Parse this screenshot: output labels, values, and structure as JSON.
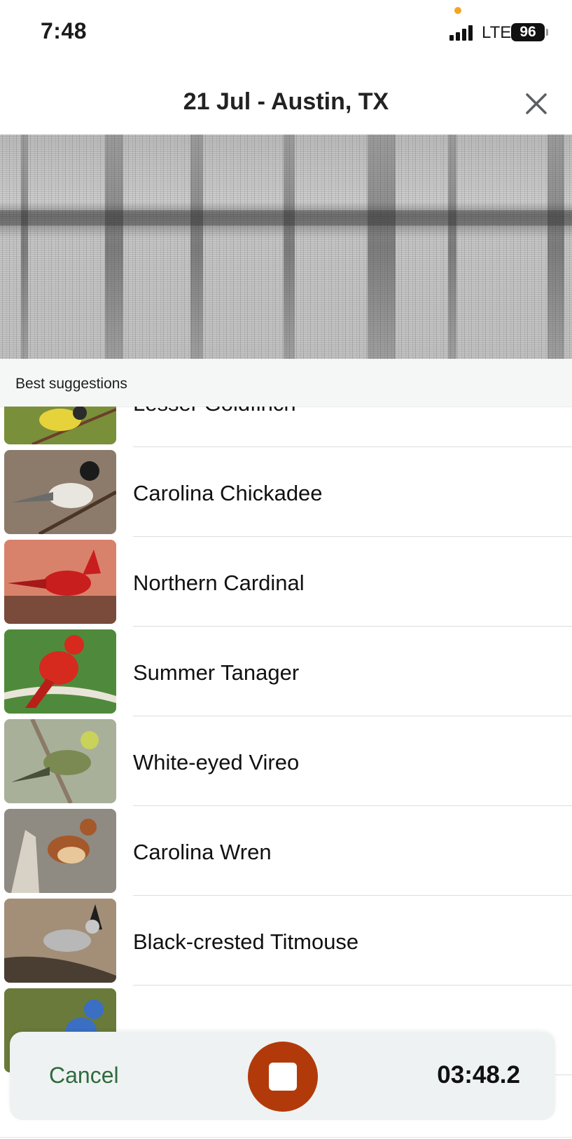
{
  "status_bar": {
    "time": "7:48",
    "network": "LTE",
    "battery": "96"
  },
  "header": {
    "title": "21 Jul - Austin, TX",
    "close_icon": "close-icon"
  },
  "section": {
    "title": "Best suggestions"
  },
  "species": [
    {
      "name": "Lesser Goldfinch",
      "colors": [
        "#7a8f3a",
        "#e6d23a",
        "#2b2b2b"
      ]
    },
    {
      "name": "Carolina Chickadee",
      "colors": [
        "#8c7b6a",
        "#1b1b1b",
        "#e9e6df"
      ]
    },
    {
      "name": "Northern Cardinal",
      "colors": [
        "#d9826b",
        "#c81e1e",
        "#5a3a2a"
      ]
    },
    {
      "name": "Summer Tanager",
      "colors": [
        "#4f8a3c",
        "#d62a1e",
        "#e9e4d8"
      ]
    },
    {
      "name": "White-eyed Vireo",
      "colors": [
        "#a9b09a",
        "#c9d25a",
        "#7b8a52"
      ]
    },
    {
      "name": "Carolina Wren",
      "colors": [
        "#8f8a82",
        "#a5582a",
        "#e8c79a"
      ]
    },
    {
      "name": "Black-crested Titmouse",
      "colors": [
        "#a38f78",
        "#b8b8b8",
        "#4a3e33"
      ]
    },
    {
      "name": "",
      "colors": [
        "#6a7a3a",
        "#3a6fc4",
        "#c48a3a"
      ]
    }
  ],
  "controls": {
    "cancel_label": "Cancel",
    "stop_icon": "stop-icon",
    "timer": "03:48.2"
  },
  "accent_colors": {
    "cancel": "#2e6b3c",
    "stop": "#b23a0a"
  }
}
